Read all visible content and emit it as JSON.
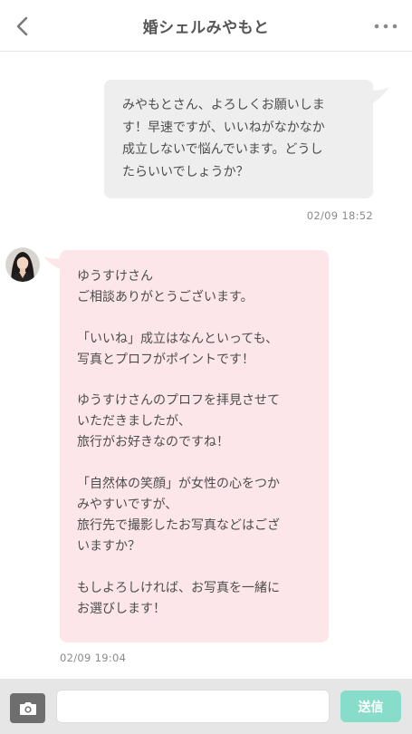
{
  "header": {
    "title": "婚シェルみやもと",
    "back_icon": "chevron-left-icon",
    "more_icon": "more-horizontal-icon"
  },
  "messages": [
    {
      "direction": "sent",
      "text": "みやもとさん、よろしくお願いしま\nす！早速ですが、いいねがなかなか\n成立しないで悩んでいます。どうし\nたらいいでしょうか？",
      "time": "02/09 18:52"
    },
    {
      "direction": "received",
      "text": "ゆうすけさん\nご相談ありがとうございます。\n\n「いいね」成立はなんといっても、\n写真とプロフがポイントです！\n\nゆうすけさんのプロフを拝見させて\nいただきましたが、\n旅行がお好きなのですね！\n\n「自然体の笑顔」が女性の心をつか\nみやすいですが、\n旅行先で撮影したお写真などはござ\nいますか？\n\nもしよろしければ、お写真を一緒に\nお選びします！",
      "time": "02/09 19:04"
    }
  ],
  "footer": {
    "camera_icon": "camera-icon",
    "input_value": "",
    "send_label": "送信"
  },
  "colors": {
    "sent_bubble": "#eeeeee",
    "received_bubble": "#fce6e9",
    "send_button": "#88dcca",
    "footer_bg": "#e6e6e6",
    "camera_button": "#6e6e6e"
  }
}
